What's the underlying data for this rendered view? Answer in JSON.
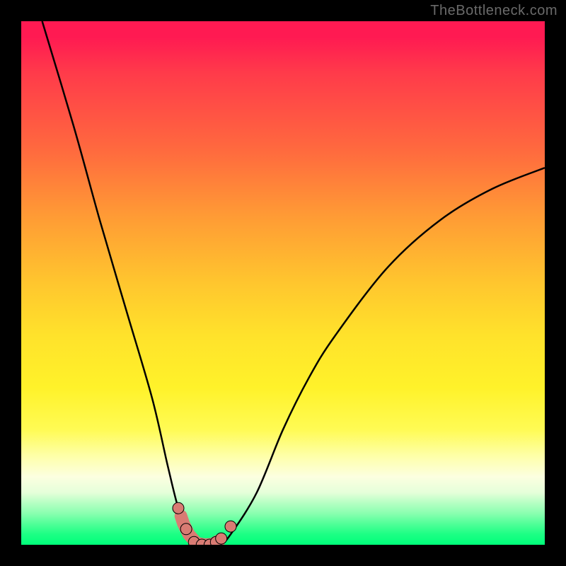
{
  "watermark": "TheBottleneck.com",
  "colors": {
    "frame": "#000000",
    "gradient_top": "#ff1a52",
    "gradient_mid": "#fff22a",
    "gradient_bottom": "#00ff7a",
    "curve_stroke": "#000000",
    "marker_fill": "#d97b73",
    "marker_stroke": "#000000"
  },
  "chart_data": {
    "type": "line",
    "title": "",
    "xlabel": "",
    "ylabel": "",
    "xlim": [
      0,
      100
    ],
    "ylim": [
      0,
      100
    ],
    "series": [
      {
        "name": "bottleneck-curve",
        "x": [
          4,
          10,
          15,
          20,
          25,
          28,
          30,
          32,
          34,
          36,
          38,
          40,
          45,
          50,
          55,
          60,
          70,
          80,
          90,
          100
        ],
        "values": [
          100,
          80,
          62,
          45,
          28,
          15,
          7,
          2,
          0,
          0,
          0,
          2,
          10,
          22,
          32,
          40,
          53,
          62,
          68,
          72
        ]
      }
    ],
    "markers": [
      {
        "x": 30.0,
        "y": 7.0
      },
      {
        "x": 31.5,
        "y": 3.0
      },
      {
        "x": 33.0,
        "y": 0.5
      },
      {
        "x": 34.5,
        "y": 0.0
      },
      {
        "x": 36.0,
        "y": 0.0
      },
      {
        "x": 37.2,
        "y": 0.5
      },
      {
        "x": 38.2,
        "y": 1.2
      },
      {
        "x": 40.0,
        "y": 3.5
      }
    ],
    "marker_trail": [
      {
        "x": 30.5,
        "y": 5.5
      },
      {
        "x": 31.0,
        "y": 4.0
      },
      {
        "x": 32.0,
        "y": 2.0
      },
      {
        "x": 33.5,
        "y": 0.3
      },
      {
        "x": 35.0,
        "y": 0.0
      },
      {
        "x": 36.5,
        "y": 0.1
      },
      {
        "x": 37.8,
        "y": 0.8
      }
    ]
  }
}
